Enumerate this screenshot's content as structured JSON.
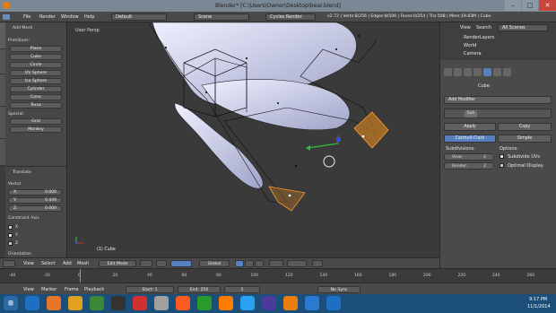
{
  "window": {
    "title": "Blender* [C:\\Users\\Owner\\Desktop\\bear.blend]",
    "minimize_glyph": "–",
    "maximize_glyph": "□",
    "close_glyph": "✕"
  },
  "menubar": {
    "items": [
      "File",
      "Render",
      "Window",
      "Help"
    ],
    "screen_layout": "Default",
    "scene": "Scene",
    "render_engine": "Cycles Render",
    "stats": "v2.72 | Verts:8/256 | Edges:8/506 | Faces:0/254 | Tris:508 | Mem:19.83M | Cube"
  },
  "toolshelf": {
    "header": "Add Mesh",
    "primitives_label": "Primitives:",
    "primitives": [
      "Plane",
      "Cube",
      "Circle",
      "UV Sphere",
      "Ico Sphere",
      "Cylinder",
      "Cone",
      "Torus"
    ],
    "special_label": "Special:",
    "special": [
      "Grid",
      "Monkey"
    ],
    "side_tabs": [
      "Tools",
      "Create",
      "Relations",
      "Animation",
      "Physics",
      "Grease Pencil"
    ],
    "translate_header": "Translate",
    "vector_label": "Vector",
    "vector": {
      "x_label": "X:",
      "x": "0.000",
      "y_label": "Y:",
      "y": "0.449",
      "z_label": "Z:",
      "z": "0.000"
    },
    "constraint_label": "Constraint Axis",
    "constraint_axes": [
      "X",
      "Y",
      "Z"
    ],
    "orientation_label": "Orientation"
  },
  "viewport": {
    "view_name": "User Persp",
    "object_label": "(1) Cube"
  },
  "viewport_header": {
    "items": [
      "View",
      "Select",
      "Add",
      "Mesh"
    ],
    "mode": "Edit Mode",
    "pivot": "Global"
  },
  "properties": {
    "outliner": {
      "view": "View",
      "search": "Search",
      "scenes": "All Scenes",
      "items": [
        "RenderLayers",
        "World",
        "Camera"
      ]
    },
    "object_name": "Cube",
    "add_modifier": "Add Modifier",
    "modifier_name": "Sub",
    "apply": "Apply",
    "copy": "Copy",
    "catmull": "Catmull-Clark",
    "simple": "Simple",
    "subdivisions_label": "Subdivisions:",
    "options_label": "Options:",
    "view_label": "View:",
    "view_value": "2",
    "render_label": "Render:",
    "render_value": "2",
    "subdivide_uvs": "Subdivide UVs",
    "optimal_display": "Optimal Display"
  },
  "timeline": {
    "ticks": [
      "-40",
      "-20",
      "0",
      "20",
      "40",
      "60",
      "80",
      "100",
      "120",
      "140",
      "160",
      "180",
      "200",
      "220",
      "240",
      "260"
    ],
    "menu": [
      "View",
      "Marker",
      "Frame",
      "Playback"
    ],
    "start_label": "Start:",
    "start": "1",
    "end_label": "End:",
    "end": "250",
    "current": "1",
    "sync": "No Sync"
  },
  "taskbar": {
    "icons": [
      "start",
      "ie",
      "firefox",
      "folder",
      "media",
      "paint",
      "chrome",
      "hp",
      "opera",
      "green-app",
      "illustrator",
      "photoshop",
      "after-effects",
      "blender",
      "globe",
      "ie2"
    ],
    "time": "9:17 PM",
    "date": "11/1/2014"
  },
  "colors": {
    "accent_blue": "#5680c2",
    "selection_orange": "#e08a1e",
    "axis_red": "#d03030",
    "axis_green": "#30c040",
    "axis_blue": "#3050e0"
  }
}
